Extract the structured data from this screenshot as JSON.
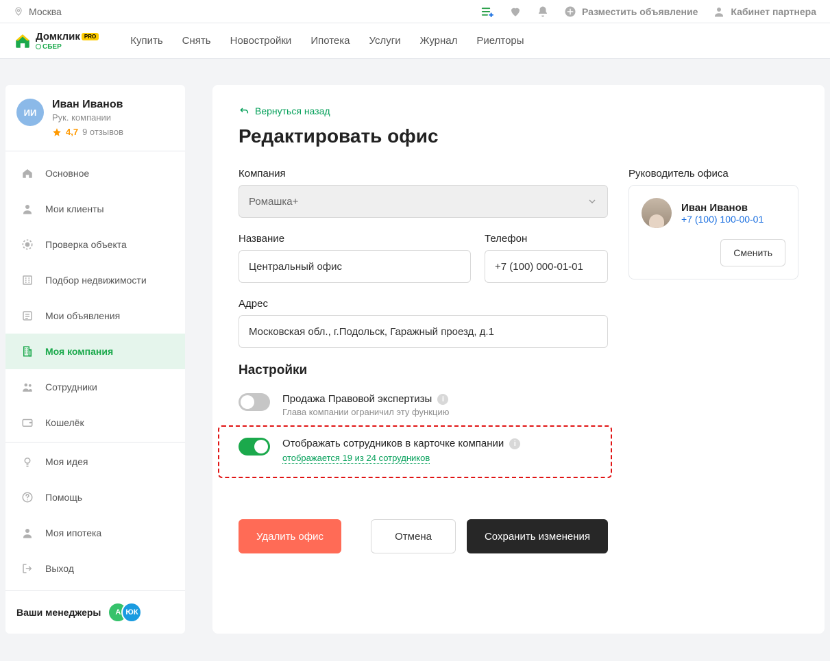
{
  "topbar": {
    "city": "Москва",
    "post_ad": "Разместить объявление",
    "partner": "Кабинет партнера"
  },
  "logo": {
    "name": "Домклик",
    "badge": "PRO",
    "sub": "СБЕР"
  },
  "nav": [
    "Купить",
    "Снять",
    "Новостройки",
    "Ипотека",
    "Услуги",
    "Журнал",
    "Риелторы"
  ],
  "user": {
    "initials": "ИИ",
    "name": "Иван Иванов",
    "role": "Рук. компании",
    "rating": "4,7",
    "reviews": "9 отзывов"
  },
  "sidebar": [
    {
      "icon": "home",
      "label": "Основное"
    },
    {
      "icon": "user",
      "label": "Мои клиенты"
    },
    {
      "icon": "check",
      "label": "Проверка объекта"
    },
    {
      "icon": "building",
      "label": "Подбор недвижимости"
    },
    {
      "icon": "list",
      "label": "Мои объявления"
    },
    {
      "icon": "company",
      "label": "Моя компания",
      "active": true
    },
    {
      "icon": "people",
      "label": "Сотрудники"
    },
    {
      "icon": "wallet",
      "label": "Кошелёк"
    },
    {
      "sep": true
    },
    {
      "icon": "bulb",
      "label": "Моя идея"
    },
    {
      "icon": "help",
      "label": "Помощь"
    },
    {
      "icon": "bank",
      "label": "Моя ипотека"
    },
    {
      "icon": "exit",
      "label": "Выход"
    }
  ],
  "managers_label": "Ваши менеджеры",
  "managers": [
    {
      "initials": "А",
      "color": "#36c26b"
    },
    {
      "initials": "ЮК",
      "color": "#1a9be0"
    }
  ],
  "content": {
    "back": "Вернуться назад",
    "h1": "Редактировать офис",
    "company_label": "Компания",
    "company_value": "Ромашка+",
    "name_label": "Название",
    "name_value": "Центральный офис",
    "phone_label": "Телефон",
    "phone_value": "+7 (100) 000-01-01",
    "address_label": "Адрес",
    "address_value": "Московская обл., г.Подольск, Гаражный проезд, д.1",
    "settings_h": "Настройки",
    "toggle1": {
      "label": "Продажа Правовой экспертизы",
      "sub": "Глава компании ограничил эту функцию"
    },
    "toggle2": {
      "label": "Отображать сотрудников в карточке компании",
      "sub_link": "отображается 19 из 24  сотрудников"
    },
    "manager_block": {
      "title": "Руководитель офиса",
      "name": "Иван Иванов",
      "phone": "+7 (100) 100-00-01",
      "change": "Сменить"
    },
    "actions": {
      "delete": "Удалить офис",
      "cancel": "Отмена",
      "save": "Сохранить изменения"
    }
  }
}
